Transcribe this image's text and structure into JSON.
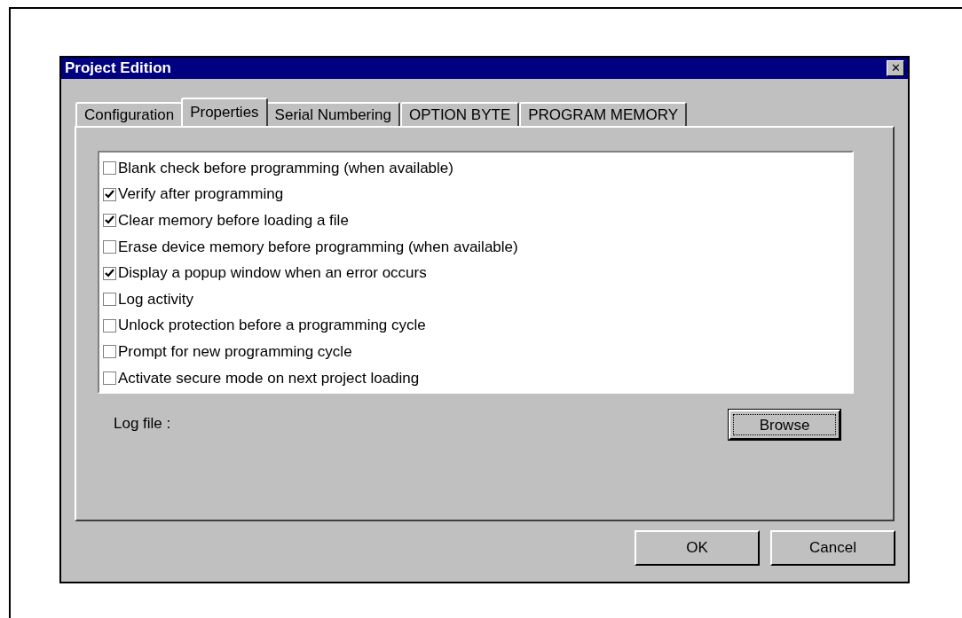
{
  "window": {
    "title": "Project Edition",
    "close": "✕"
  },
  "tabs": [
    {
      "label": "Configuration",
      "selected": false
    },
    {
      "label": "Properties",
      "selected": true
    },
    {
      "label": "Serial Numbering",
      "selected": false
    },
    {
      "label": "OPTION BYTE",
      "selected": false
    },
    {
      "label": "PROGRAM MEMORY",
      "selected": false
    }
  ],
  "options": [
    {
      "label": "Blank check before programming (when available)",
      "checked": false
    },
    {
      "label": "Verify after programming",
      "checked": true
    },
    {
      "label": "Clear memory before loading a file",
      "checked": true
    },
    {
      "label": "Erase device memory before programming (when available)",
      "checked": false
    },
    {
      "label": "Display a popup window when an error occurs",
      "checked": true
    },
    {
      "label": "Log activity",
      "checked": false
    },
    {
      "label": "Unlock protection before a programming cycle",
      "checked": false
    },
    {
      "label": "Prompt for new programming cycle",
      "checked": false
    },
    {
      "label": "Activate secure mode on next project loading",
      "checked": false
    }
  ],
  "log_file": {
    "label": "Log file :",
    "browse": "Browse"
  },
  "buttons": [
    "OK",
    "Cancel"
  ]
}
